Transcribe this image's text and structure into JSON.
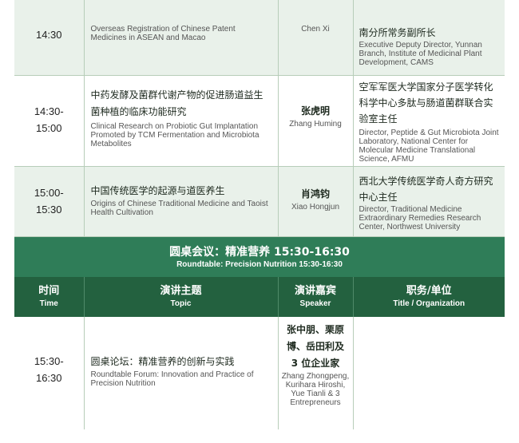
{
  "rows_top": [
    {
      "time_lines": [
        "14:30"
      ],
      "topic_cn_lines": [],
      "topic_en": "Overseas Registration of Chinese Patent Medicines in ASEAN and Macao",
      "speaker_cn": "",
      "speaker_en": "Chen Xi",
      "org_cn": "南分所常务副所长",
      "org_en": "Executive Deputy Director, Yunnan Branch, Institute of Medicinal Plant Development, CAMS"
    },
    {
      "time_lines": [
        "14:30-",
        "15:00"
      ],
      "topic_cn_lines": [
        "中药发酵及菌群代谢产物的促进肠道益生",
        "菌种植的临床功能研究"
      ],
      "topic_en": "Clinical Research on Probiotic Gut Implantation Promoted by TCM Fermentation and Microbiota Metabolites",
      "speaker_cn": "张虎明",
      "speaker_en": "Zhang Huming",
      "org_cn": "空军军医大学国家分子医学转化科学中心多肽与肠道菌群联合实验室主任",
      "org_en": "Director, Peptide & Gut Microbiota Joint Laboratory, National Center for Molecular Medicine Translational Science, AFMU"
    },
    {
      "time_lines": [
        "15:00-",
        "15:30"
      ],
      "topic_cn_lines": [
        "中国传统医学的起源与道医养生"
      ],
      "topic_en": "Origins of Chinese Traditional Medicine and Taoist Health Cultivation",
      "speaker_cn": "肖鸿钧",
      "speaker_en": "Xiao Hongjun",
      "org_cn": "西北大学传统医学奇人奇方研究中心主任",
      "org_en": "Director, Traditional Medicine Extraordinary Remedies Research Center, Northwest University"
    }
  ],
  "banner": {
    "cn": "圆桌会议：精准营养 15:30-16:30",
    "en": "Roundtable: Precision Nutrition 15:30-16:30"
  },
  "header": {
    "time_cn": "时间",
    "time_en": "Time",
    "topic_cn": "演讲主题",
    "topic_en": "Topic",
    "speaker_cn": "演讲嘉宾",
    "speaker_en": "Speaker",
    "org_cn": "职务/单位",
    "org_en": "Title / Organization"
  },
  "row_bottom": {
    "time_lines": [
      "15:30-",
      "16:30"
    ],
    "topic_cn": "圆桌论坛：精准营养的创新与实践",
    "topic_en": "Roundtable Forum: Innovation and Practice of Precision Nutrition",
    "speaker_cn_lines": [
      "张中朋、栗原",
      "博、岳田利及",
      "3 位企业家"
    ],
    "speaker_en": "Zhang Zhongpeng, Kurihara Hiroshi, Yue Tianli & 3 Entrepreneurs",
    "org_cn": "",
    "org_en": ""
  },
  "colors": {
    "row_green": "#e9f1ea",
    "banner": "#2f7d58",
    "header": "#23613f"
  }
}
